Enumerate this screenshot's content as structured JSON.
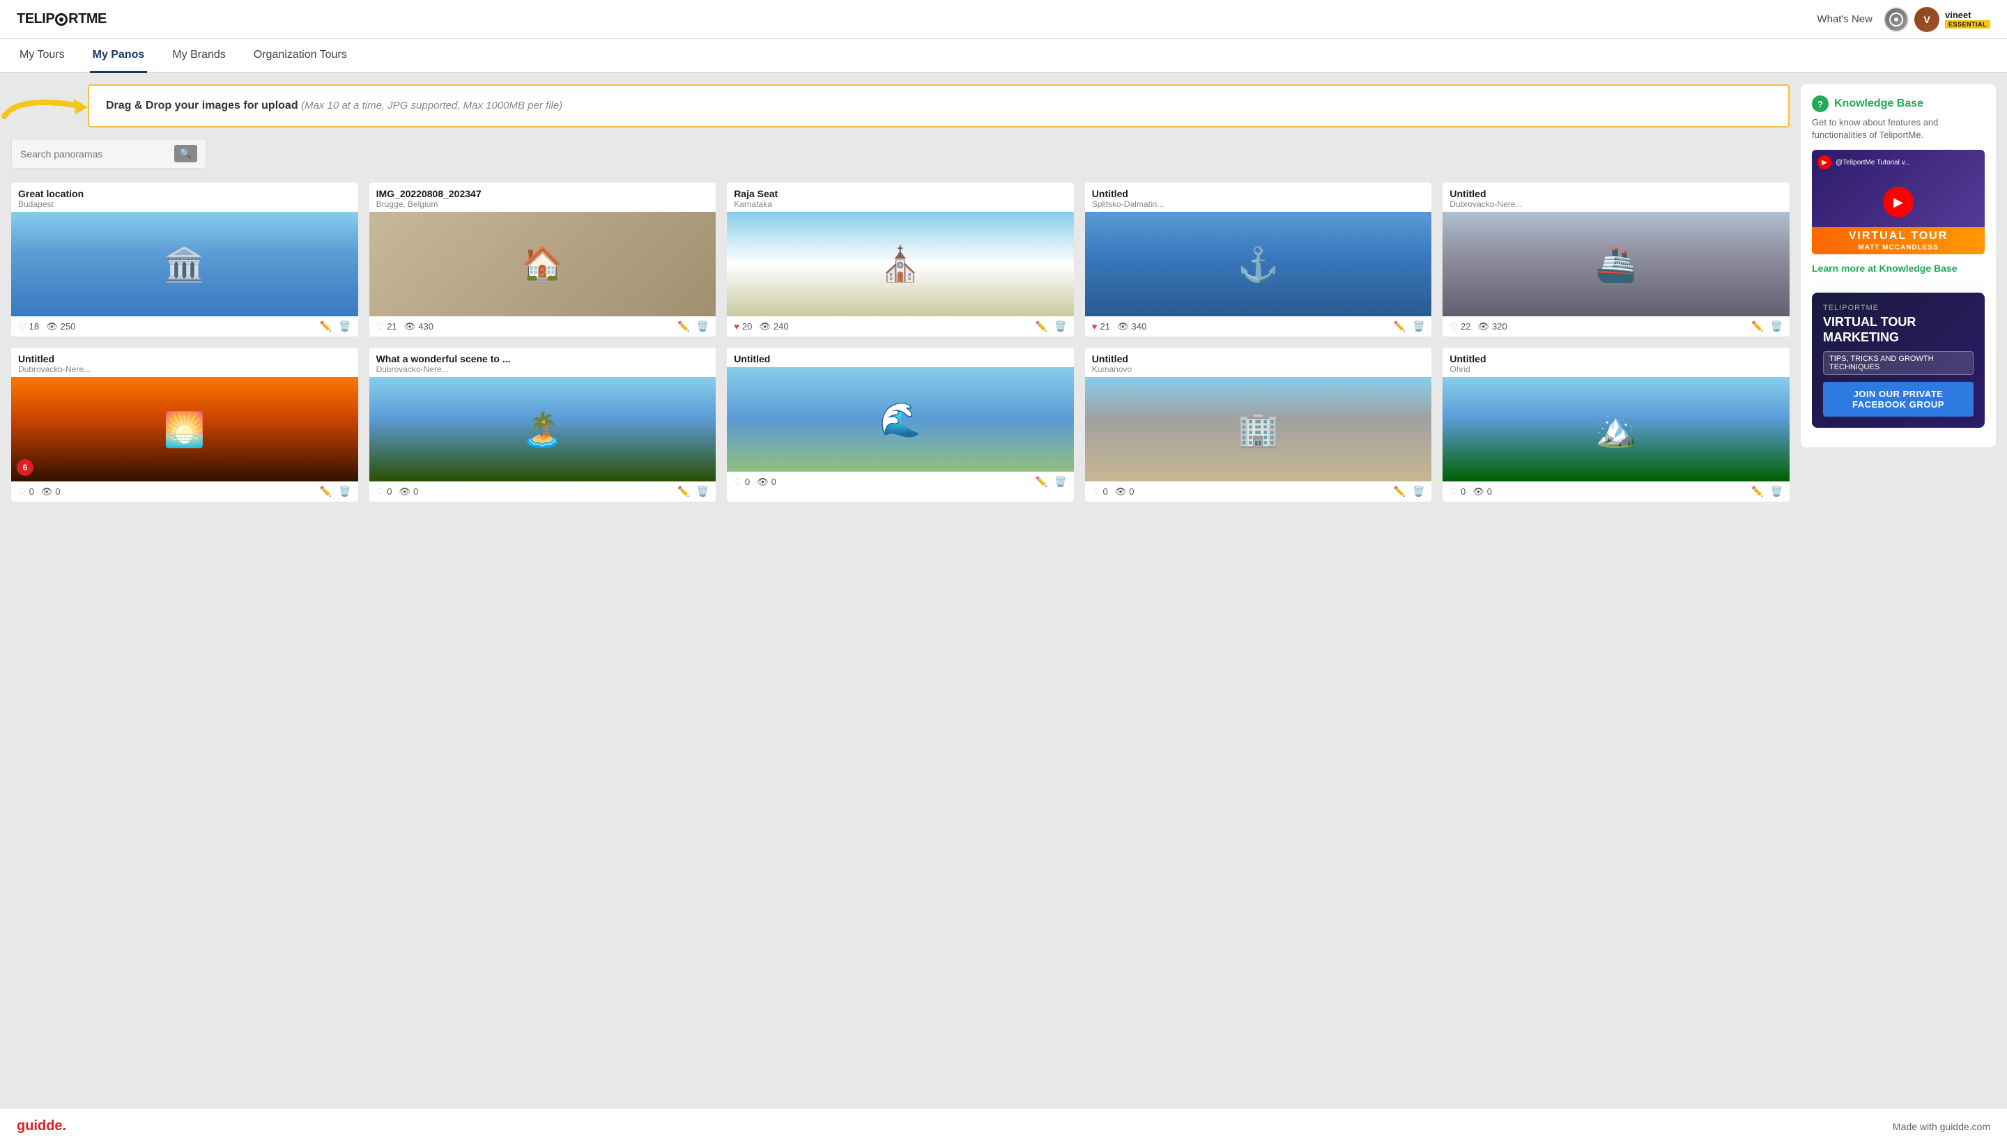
{
  "app": {
    "logo": "TELIPORTME"
  },
  "header": {
    "whats_new": "What's New",
    "user": {
      "name": "vineet",
      "badge": "ESSENTIAL"
    }
  },
  "nav": {
    "tabs": [
      {
        "label": "My Tours",
        "active": false
      },
      {
        "label": "My Panos",
        "active": true
      },
      {
        "label": "My Brands",
        "active": false
      },
      {
        "label": "Organization Tours",
        "active": false
      }
    ]
  },
  "drop_zone": {
    "text": "Drag & Drop your images for upload ",
    "subtext": "(Max 10 at a time, JPG supported, Max 1000MB per file)"
  },
  "search": {
    "placeholder": "Search panoramas"
  },
  "panos": [
    {
      "title": "Great location",
      "location": "Budapest",
      "likes": 18,
      "views": 250,
      "liked": false,
      "bg_class": "bg-blue-sky",
      "emoji": "🏛️"
    },
    {
      "title": "IMG_20220808_202347",
      "location": "Brugge, Belgium",
      "likes": 21,
      "views": 430,
      "liked": false,
      "bg_class": "bg-interior",
      "emoji": "🏠"
    },
    {
      "title": "Raja Seat",
      "location": "Karnataka",
      "likes": 20,
      "views": 240,
      "liked": true,
      "bg_class": "bg-white-arch",
      "emoji": "⛪"
    },
    {
      "title": "Untitled",
      "location": "Splitsko-Dalmatin...",
      "likes": 21,
      "views": 340,
      "liked": true,
      "bg_class": "bg-harbor",
      "emoji": "⚓"
    },
    {
      "title": "Untitled",
      "location": "Dubrovacko-Nere...",
      "likes": 22,
      "views": 320,
      "liked": false,
      "bg_class": "bg-boat",
      "emoji": "🚢"
    },
    {
      "title": "Untitled",
      "location": "Dubrovacko-Nere...",
      "likes": 0,
      "views": 0,
      "liked": false,
      "bg_class": "bg-sunset",
      "emoji": "🌅",
      "badge": "6"
    },
    {
      "title": "What a wonderful scene to ...",
      "location": "Dubrovacko-Nere...",
      "likes": 0,
      "views": 0,
      "liked": false,
      "bg_class": "bg-island",
      "emoji": "🏝️"
    },
    {
      "title": "Untitled",
      "location": "",
      "likes": 0,
      "views": 0,
      "liked": false,
      "bg_class": "bg-coast",
      "emoji": "🌊"
    },
    {
      "title": "Untitled",
      "location": "Kumanovo",
      "likes": 0,
      "views": 0,
      "liked": false,
      "bg_class": "bg-building",
      "emoji": "🏢"
    },
    {
      "title": "Untitled",
      "location": "Ohrid",
      "likes": 0,
      "views": 0,
      "liked": false,
      "bg_class": "bg-lake",
      "emoji": "🏔️"
    }
  ],
  "sidebar": {
    "knowledge_base_title": "Knowledge Base",
    "knowledge_base_desc": "Get to know about features and functionalities of TeliportMe.",
    "video_title": "@TeliportMe Tutorial v...",
    "virtual_tour_label": "VIRTUAL TOUR",
    "presenter": "MATT MCCANDLESS",
    "learn_more": "Learn more at Knowledge Base",
    "marketing_brand": "TELIPORTME",
    "marketing_title": "VIRTUAL TOUR MARKETING",
    "marketing_sub": "TIPS, TRICKS AND GROWTH TECHNIQUES",
    "fb_btn": "JOIN OUR PRIVATE FACEBOOK GROUP"
  },
  "footer": {
    "logo": "guidde.",
    "text": "Made with guidde.com"
  }
}
